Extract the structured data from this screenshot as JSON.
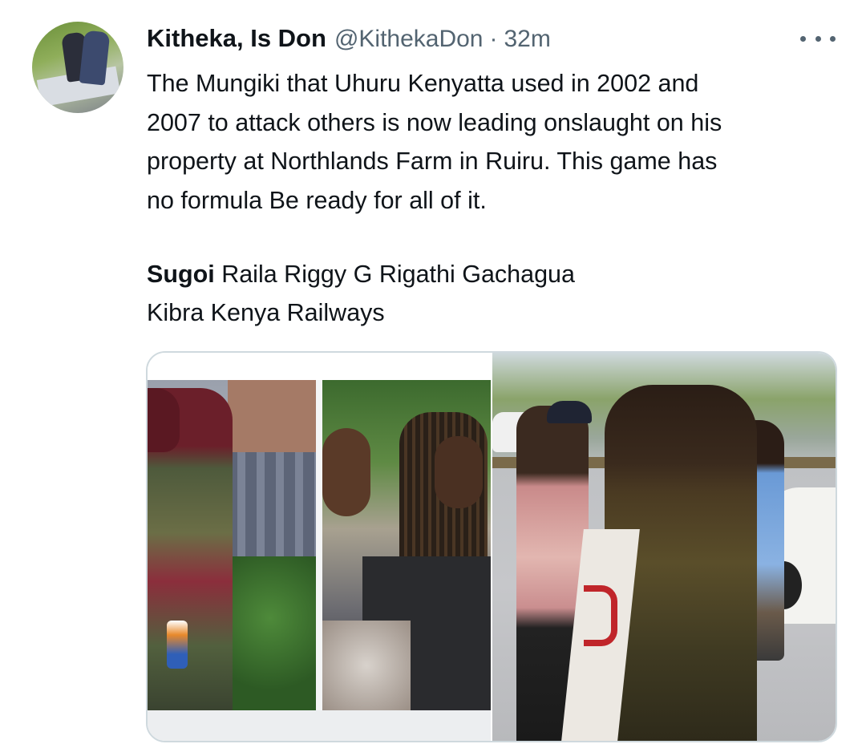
{
  "tweet": {
    "author_name": "Kitheka, Is Don",
    "handle": "@KithekaDon",
    "separator": "·",
    "time": "32m",
    "text_lines": [
      "The Mungiki that Uhuru Kenyatta used in 2002 and",
      "2007 to attack others is now leading onslaught on his",
      "property at Northlands Farm in Ruiru.  This game has",
      "no formula Be ready for all of it."
    ],
    "tags_bold": "Sugoi",
    "tags_line1_rest": " Raila Riggy G Rigathi Gachagua",
    "tags_line2": "Kibra Kenya Railways"
  },
  "icons": {
    "more": "more-horizontal-icon"
  },
  "colors": {
    "text_primary": "#0f1419",
    "text_secondary": "#536471",
    "border": "#cfd9de"
  }
}
